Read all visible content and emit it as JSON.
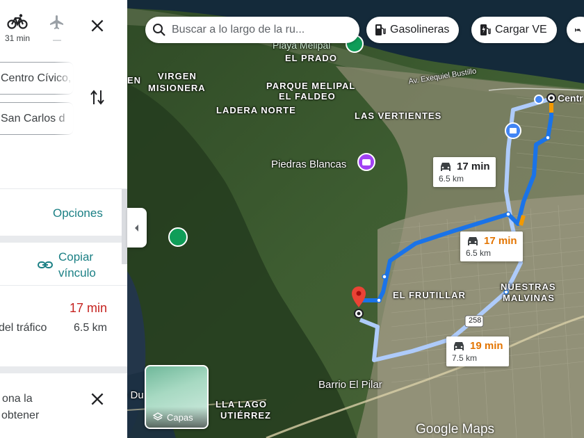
{
  "travel_modes": {
    "bike": {
      "duration": "31 min"
    },
    "flight": {
      "duration": "—"
    }
  },
  "origin_value": "Centro Cívico, R",
  "destination_value": "San Carlos d",
  "options_label": "Opciones",
  "copy_link_line1": "Copiar",
  "copy_link_line2": "vínculo",
  "route": {
    "time": "17 min",
    "traffic": "del tráfico",
    "distance": "6.5 km"
  },
  "notice_line1": "ona la",
  "notice_line2": "obtener",
  "search": {
    "placeholder": "Buscar a lo largo de la ru..."
  },
  "chips": {
    "gas": "Gasolineras",
    "ev": "Cargar VE"
  },
  "places": {
    "virgen": "VIRGEN",
    "misionera": "MISIONERA",
    "parque": "PARQUE MELIPAL",
    "faldeo": "EL FALDEO",
    "ladera": "LADERA NORTE",
    "vertientes": "LAS VERTIENTES",
    "prado": "EL PRADO",
    "frutillar": "EL FRUTILLAR",
    "nuestras": "NUESTRAS",
    "malvinas": "MALVINAS",
    "lago": "LLA LAGO",
    "gutierrez": "UTIÉRREZ",
    "en": "EN",
    "du": "e Du"
  },
  "pois": {
    "playa": "Playa Melipal",
    "piedras": "Piedras Blancas",
    "pilar": "Barrio El Pilar",
    "centro": "Centr",
    "bustillo": "Av. Exequiel Bustillo",
    "ruta": "258"
  },
  "callouts": {
    "a": {
      "time": "17 min",
      "dist": "6.5 km"
    },
    "b": {
      "time": "17 min",
      "dist": "6.5 km"
    },
    "c": {
      "time": "19 min",
      "dist": "7.5 km"
    }
  },
  "layers_label": "Capas",
  "logo": "Google Maps",
  "colors": {
    "route_primary": "#1a73e8",
    "route_alt": "#aecbfa",
    "traffic_orange": "#f29900",
    "accent_teal": "#1a7f84",
    "time_red": "#c5221f"
  }
}
